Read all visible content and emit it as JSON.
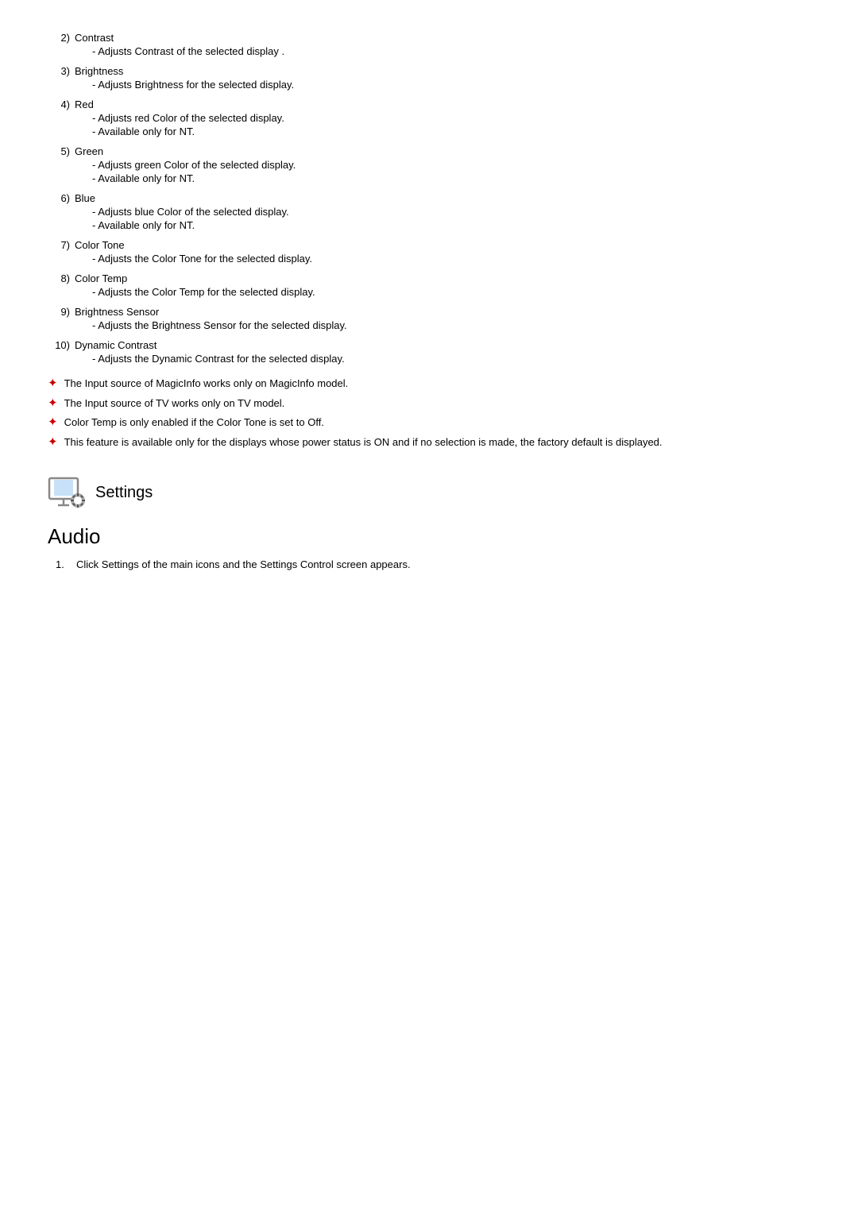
{
  "items": [
    {
      "number": "2)",
      "title": "Contrast",
      "sub_items": [
        "- Adjusts Contrast of the selected display ."
      ]
    },
    {
      "number": "3)",
      "title": "Brightness",
      "sub_items": [
        "- Adjusts Brightness for the selected display."
      ]
    },
    {
      "number": "4)",
      "title": "Red",
      "sub_items": [
        "- Adjusts red Color of the selected display.",
        "- Available  only for NT."
      ]
    },
    {
      "number": "5)",
      "title": "Green",
      "sub_items": [
        "- Adjusts green Color of the selected display.",
        "- Available  only for NT."
      ]
    },
    {
      "number": "6)",
      "title": "Blue",
      "sub_items": [
        "- Adjusts blue Color of the selected display.",
        "- Available  only for NT."
      ]
    },
    {
      "number": "7)",
      "title": "Color Tone",
      "sub_items": [
        "- Adjusts the Color Tone for the selected display."
      ]
    },
    {
      "number": "8)",
      "title": "Color Temp",
      "sub_items": [
        "- Adjusts the Color Temp for the selected display."
      ]
    },
    {
      "number": "9)",
      "title": "Brightness Sensor",
      "sub_items": [
        "- Adjusts the Brightness Sensor for the selected display."
      ]
    },
    {
      "number": "10)",
      "title": "Dynamic Contrast",
      "sub_items": [
        "- Adjusts the Dynamic Contrast for the selected display."
      ]
    }
  ],
  "notes": [
    "The Input source of MagicInfo works only on MagicInfo model.",
    "The Input source of TV works only on TV model.",
    "Color Temp is only enabled if the Color Tone is set to Off.",
    "This feature is available only for the displays whose power status is ON and if no selection is made, the factory default is displayed."
  ],
  "settings": {
    "section_title": "Settings",
    "audio_title": "Audio",
    "steps": [
      "Click Settings of the main icons and the Settings Control screen appears."
    ]
  }
}
